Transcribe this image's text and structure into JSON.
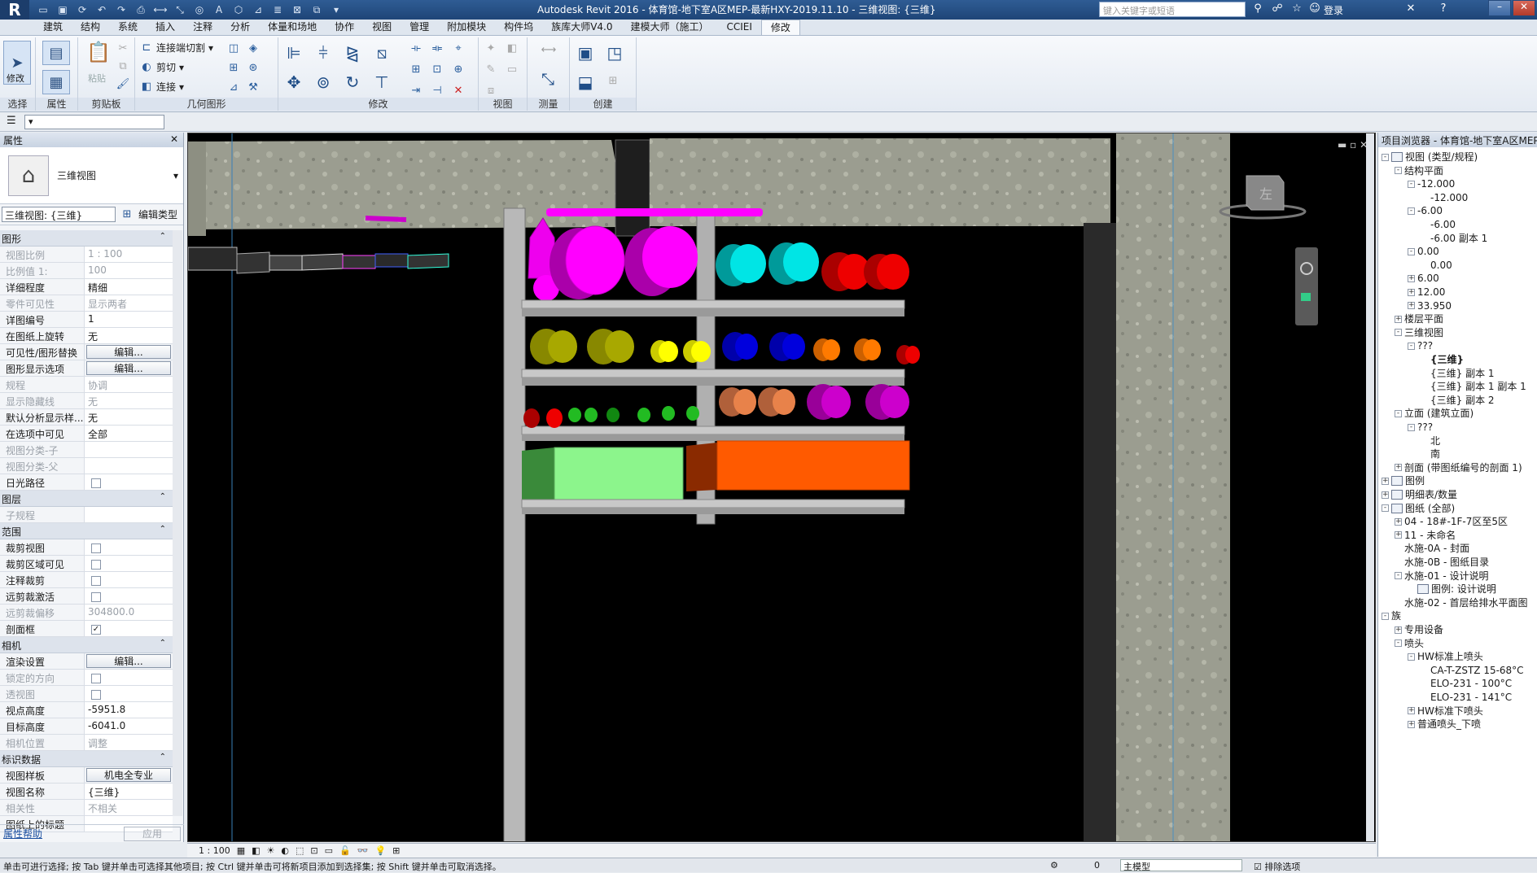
{
  "title_bar": {
    "app_menu": "R",
    "title": "Autodesk Revit 2016 -     体育馆-地下室A区MEP-最新HXY-2019.11.10 - 三维视图: {三维}",
    "search_placeholder": "键入关键字或短语",
    "login": "登录",
    "help": "?"
  },
  "ribbon_tabs": [
    "建筑",
    "结构",
    "系统",
    "插入",
    "注释",
    "分析",
    "体量和场地",
    "协作",
    "视图",
    "管理",
    "附加模块",
    "构件坞",
    "族库大师V4.0",
    "建模大师（施工）",
    "CCIEI",
    "修改"
  ],
  "active_tab": "修改",
  "ribbon": {
    "select_panel": {
      "btn": "修改",
      "label": "选择"
    },
    "props_panel": {
      "label": "属性"
    },
    "clipboard_panel": {
      "paste": "粘贴",
      "label": "剪贴板"
    },
    "geometry_panel": {
      "items": [
        "连接端切割",
        "剪切",
        "连接"
      ],
      "label": "几何图形"
    },
    "modify_panel": {
      "label": "修改"
    },
    "view_panel": {
      "label": "视图"
    },
    "measure_panel": {
      "label": "测量"
    },
    "create_panel": {
      "label": "创建"
    }
  },
  "properties": {
    "header": "属性",
    "type_name": "三维视图",
    "instance_select": "三维视图: {三维}",
    "edit_type": "编辑类型",
    "groups": [
      {
        "name": "图形",
        "rows": [
          {
            "k": "视图比例",
            "v": "1 : 100",
            "dis": true
          },
          {
            "k": "比例值 1:",
            "v": "100",
            "dis": true
          },
          {
            "k": "详细程度",
            "v": "精细"
          },
          {
            "k": "零件可见性",
            "v": "显示两者",
            "dis": true
          },
          {
            "k": "详图编号",
            "v": "1"
          },
          {
            "k": "在图纸上旋转",
            "v": "无"
          },
          {
            "k": "可见性/图形替换",
            "btn": "编辑..."
          },
          {
            "k": "图形显示选项",
            "btn": "编辑..."
          },
          {
            "k": "规程",
            "v": "协调",
            "dis": true
          },
          {
            "k": "显示隐藏线",
            "v": "无",
            "dis": true
          },
          {
            "k": "默认分析显示样...",
            "v": "无"
          },
          {
            "k": "在选项中可见",
            "v": "全部"
          },
          {
            "k": "视图分类-子",
            "v": "",
            "dis": true
          },
          {
            "k": "视图分类-父",
            "v": "",
            "dis": true
          },
          {
            "k": "日光路径",
            "chk": ""
          }
        ]
      },
      {
        "name": "图层",
        "rows": [
          {
            "k": "子规程",
            "v": "",
            "dis": true
          }
        ]
      },
      {
        "name": "范围",
        "rows": [
          {
            "k": "裁剪视图",
            "chk": ""
          },
          {
            "k": "裁剪区域可见",
            "chk": ""
          },
          {
            "k": "注释裁剪",
            "chk": ""
          },
          {
            "k": "远剪裁激活",
            "chk": ""
          },
          {
            "k": "远剪裁偏移",
            "v": "304800.0",
            "dis": true
          },
          {
            "k": "剖面框",
            "chk": "✓"
          }
        ]
      },
      {
        "name": "相机",
        "rows": [
          {
            "k": "渲染设置",
            "btn": "编辑..."
          },
          {
            "k": "锁定的方向",
            "chk": "",
            "dis": true
          },
          {
            "k": "透视图",
            "chk": "",
            "dis": true
          },
          {
            "k": "视点高度",
            "v": "-5951.8"
          },
          {
            "k": "目标高度",
            "v": "-6041.0"
          },
          {
            "k": "相机位置",
            "v": "调整",
            "dis": true
          }
        ]
      },
      {
        "name": "标识数据",
        "rows": [
          {
            "k": "视图样板",
            "btn": "机电全专业"
          },
          {
            "k": "视图名称",
            "v": "{三维}"
          },
          {
            "k": "相关性",
            "v": "不相关",
            "dis": true
          },
          {
            "k": "图纸上的标题",
            "v": ""
          }
        ]
      }
    ],
    "help": "属性帮助",
    "apply": "应用"
  },
  "view_control": {
    "scale": "1 : 100"
  },
  "browser": {
    "header": "项目浏览器 - 体育馆-地下室A区MEP-...",
    "nodes": [
      {
        "d": 0,
        "t": "视图 (类型/规程)",
        "box": "-",
        "icon": true
      },
      {
        "d": 1,
        "t": "结构平面",
        "box": "-"
      },
      {
        "d": 2,
        "t": "-12.000",
        "box": "-"
      },
      {
        "d": 3,
        "t": "-12.000"
      },
      {
        "d": 2,
        "t": "-6.00",
        "box": "-"
      },
      {
        "d": 3,
        "t": "-6.00"
      },
      {
        "d": 3,
        "t": "-6.00 副本 1"
      },
      {
        "d": 2,
        "t": "0.00",
        "box": "-"
      },
      {
        "d": 3,
        "t": "0.00"
      },
      {
        "d": 2,
        "t": "6.00",
        "box": "+"
      },
      {
        "d": 2,
        "t": "12.00",
        "box": "+"
      },
      {
        "d": 2,
        "t": "33.950",
        "box": "+"
      },
      {
        "d": 1,
        "t": "楼层平面",
        "box": "+"
      },
      {
        "d": 1,
        "t": "三维视图",
        "box": "-"
      },
      {
        "d": 2,
        "t": "???",
        "box": "-"
      },
      {
        "d": 3,
        "t": "{三维}",
        "bold": true
      },
      {
        "d": 3,
        "t": "{三维} 副本 1"
      },
      {
        "d": 3,
        "t": "{三维} 副本 1 副本 1"
      },
      {
        "d": 3,
        "t": "{三维} 副本 2"
      },
      {
        "d": 1,
        "t": "立面 (建筑立面)",
        "box": "-"
      },
      {
        "d": 2,
        "t": "???",
        "box": "-"
      },
      {
        "d": 3,
        "t": "北"
      },
      {
        "d": 3,
        "t": "南"
      },
      {
        "d": 1,
        "t": "剖面 (带图纸编号的剖面 1)",
        "box": "+"
      },
      {
        "d": 0,
        "t": "图例",
        "box": "+",
        "icon": true
      },
      {
        "d": 0,
        "t": "明细表/数量",
        "box": "+",
        "icon": true
      },
      {
        "d": 0,
        "t": "图纸 (全部)",
        "box": "-",
        "icon": true
      },
      {
        "d": 1,
        "t": "04 - 18#-1F-7区至5区",
        "box": "+"
      },
      {
        "d": 1,
        "t": "11 - 未命名",
        "box": "+"
      },
      {
        "d": 1,
        "t": "水施-0A - 封面"
      },
      {
        "d": 1,
        "t": "水施-0B - 图纸目录"
      },
      {
        "d": 1,
        "t": "水施-01 - 设计说明",
        "box": "-"
      },
      {
        "d": 2,
        "t": "图例: 设计说明",
        "icon": true
      },
      {
        "d": 1,
        "t": "水施-02 - 首层给排水平面图"
      },
      {
        "d": 0,
        "t": "族",
        "box": "-"
      },
      {
        "d": 1,
        "t": "专用设备",
        "box": "+"
      },
      {
        "d": 1,
        "t": "喷头",
        "box": "-"
      },
      {
        "d": 2,
        "t": "HW标准上喷头",
        "box": "-"
      },
      {
        "d": 3,
        "t": "CA-T-ZSTZ 15-68°C"
      },
      {
        "d": 3,
        "t": "ELO-231 - 100°C"
      },
      {
        "d": 3,
        "t": "ELO-231 - 141°C"
      },
      {
        "d": 2,
        "t": "HW标准下喷头",
        "box": "+"
      },
      {
        "d": 2,
        "t": "普通喷头_下喷",
        "box": "+"
      }
    ]
  },
  "viewcube": {
    "face": "左"
  },
  "status": {
    "text": "单击可进行选择; 按 Tab 键并单击可选择其他项目; 按 Ctrl 键并单击可将新项目添加到选择集; 按 Shift 键并单击可取消选择。",
    "coord": "0",
    "model": "主模型",
    "exclude": "排除选项"
  },
  "colors": {
    "magenta": "#ff00ff",
    "cyan": "#00e5e5",
    "red": "#ee0000",
    "olive": "#a8a800",
    "yellow": "#ffff00",
    "blue": "#0000dd",
    "orange": "#ff7a00",
    "salmon": "#e8824a",
    "purple": "#cc00cc",
    "green": "#22bb22",
    "lightgreen": "#8cf58c",
    "duct_orange": "#ff5a00",
    "concrete": "#9a9c8e"
  }
}
